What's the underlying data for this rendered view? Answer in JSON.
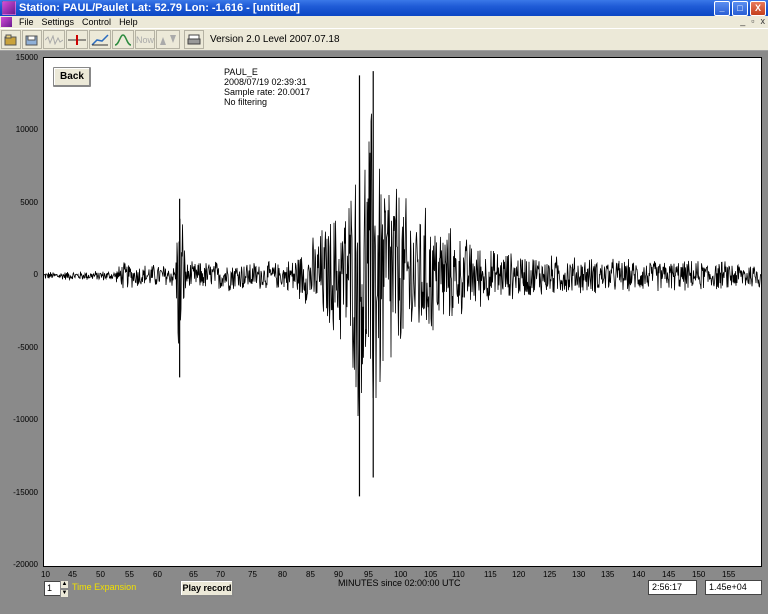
{
  "window": {
    "title": "Station: PAUL/Paulet Lat: 52.79 Lon: -1.616 - [untitled]",
    "controls": [
      "_",
      "□",
      "X"
    ]
  },
  "menu": {
    "items": [
      "File",
      "Settings",
      "Control",
      "Help"
    ],
    "mdi_controls": [
      "_",
      "▫",
      "x"
    ]
  },
  "toolbar": {
    "now_label": "Now",
    "version_text": "Version 2.0 Level 2007.07.18"
  },
  "plot": {
    "back_label": "Back",
    "info": [
      "PAUL_E",
      "2008/07/19 02:39:31",
      "Sample rate: 20.0017",
      "No filtering"
    ],
    "x_axis_label": "MINUTES since 02:00:00 UTC"
  },
  "controls": {
    "time_expansion_value": "1",
    "time_expansion_label": "Time Expansion",
    "play_label": "Play record",
    "time_readout": "2:56:17",
    "amplitude_readout": "1.45e+04"
  },
  "chart_data": {
    "type": "line",
    "title": "",
    "xlabel": "MINUTES since 02:00:00 UTC",
    "ylabel": "",
    "xlim": [
      10,
      160
    ],
    "ylim": [
      -20000,
      15000
    ],
    "x_ticks": [
      "10",
      "45",
      "50",
      "55",
      "60",
      "65",
      "70",
      "75",
      "80",
      "85",
      "90",
      "95",
      "100",
      "105",
      "110",
      "115",
      "120",
      "125",
      "130",
      "135",
      "140",
      "145",
      "150",
      "155"
    ],
    "y_ticks": [
      "15000",
      "10000",
      "5000",
      "0",
      "-5000",
      "-10000",
      "-15000",
      "-20000"
    ],
    "series": [
      {
        "x": [
          40,
          52,
          53,
          55,
          62,
          62.5,
          63,
          64,
          70,
          80,
          84,
          86,
          88,
          90,
          91,
          92,
          93,
          94,
          95,
          96,
          97,
          98,
          100,
          103,
          106,
          110,
          115,
          120,
          130,
          140,
          155,
          160
        ],
        "envelope": [
          300,
          400,
          1100,
          900,
          900,
          7000,
          5300,
          1000,
          1200,
          1000,
          2200,
          3500,
          4500,
          5600,
          6500,
          8000,
          13800,
          9700,
          14100,
          11000,
          8500,
          9000,
          6000,
          5500,
          4300,
          3000,
          2000,
          1700,
          1400,
          1200,
          1100,
          1000
        ],
        "peaks": [
          {
            "x": 62.7,
            "max": 5300,
            "min": -7000
          },
          {
            "x": 92.8,
            "max": 13800,
            "min": -15200
          },
          {
            "x": 95.1,
            "max": 14100,
            "min": -13900
          }
        ]
      }
    ]
  }
}
